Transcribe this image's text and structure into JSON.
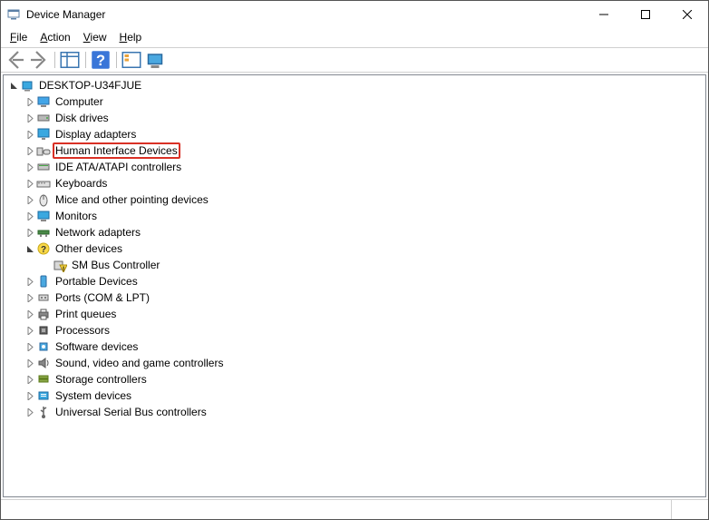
{
  "window": {
    "title": "Device Manager"
  },
  "menu": {
    "file": "File",
    "action": "Action",
    "view": "View",
    "help": "Help"
  },
  "tree": {
    "root": "DESKTOP-U34FJUE",
    "nodes": [
      {
        "label": "Computer",
        "icon": "monitor",
        "expanded": false
      },
      {
        "label": "Disk drives",
        "icon": "disk",
        "expanded": false
      },
      {
        "label": "Display adapters",
        "icon": "display",
        "expanded": false
      },
      {
        "label": "Human Interface Devices",
        "icon": "hid",
        "expanded": false,
        "highlighted": true
      },
      {
        "label": "IDE ATA/ATAPI controllers",
        "icon": "ide",
        "expanded": false
      },
      {
        "label": "Keyboards",
        "icon": "keyboard",
        "expanded": false
      },
      {
        "label": "Mice and other pointing devices",
        "icon": "mouse",
        "expanded": false
      },
      {
        "label": "Monitors",
        "icon": "monitor2",
        "expanded": false
      },
      {
        "label": "Network adapters",
        "icon": "network",
        "expanded": false
      },
      {
        "label": "Other devices",
        "icon": "other",
        "expanded": true,
        "children": [
          {
            "label": "SM Bus Controller",
            "icon": "warning"
          }
        ]
      },
      {
        "label": "Portable Devices",
        "icon": "portable",
        "expanded": false
      },
      {
        "label": "Ports (COM & LPT)",
        "icon": "ports",
        "expanded": false
      },
      {
        "label": "Print queues",
        "icon": "printer",
        "expanded": false
      },
      {
        "label": "Processors",
        "icon": "cpu",
        "expanded": false
      },
      {
        "label": "Software devices",
        "icon": "software",
        "expanded": false
      },
      {
        "label": "Sound, video and game controllers",
        "icon": "sound",
        "expanded": false
      },
      {
        "label": "Storage controllers",
        "icon": "storage",
        "expanded": false
      },
      {
        "label": "System devices",
        "icon": "system",
        "expanded": false
      },
      {
        "label": "Universal Serial Bus controllers",
        "icon": "usb",
        "expanded": false
      }
    ]
  }
}
